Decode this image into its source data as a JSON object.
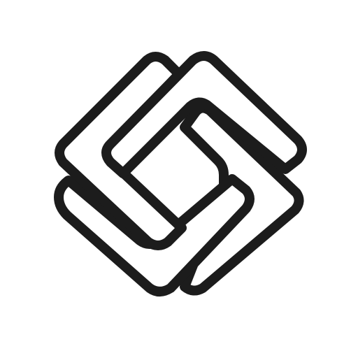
{
  "logo": {
    "icon": "interlocking-diamond-knot-icon",
    "stroke_color": "#1c1c1c",
    "fill_color": "#ffffff",
    "background_color": "#ffffff"
  }
}
